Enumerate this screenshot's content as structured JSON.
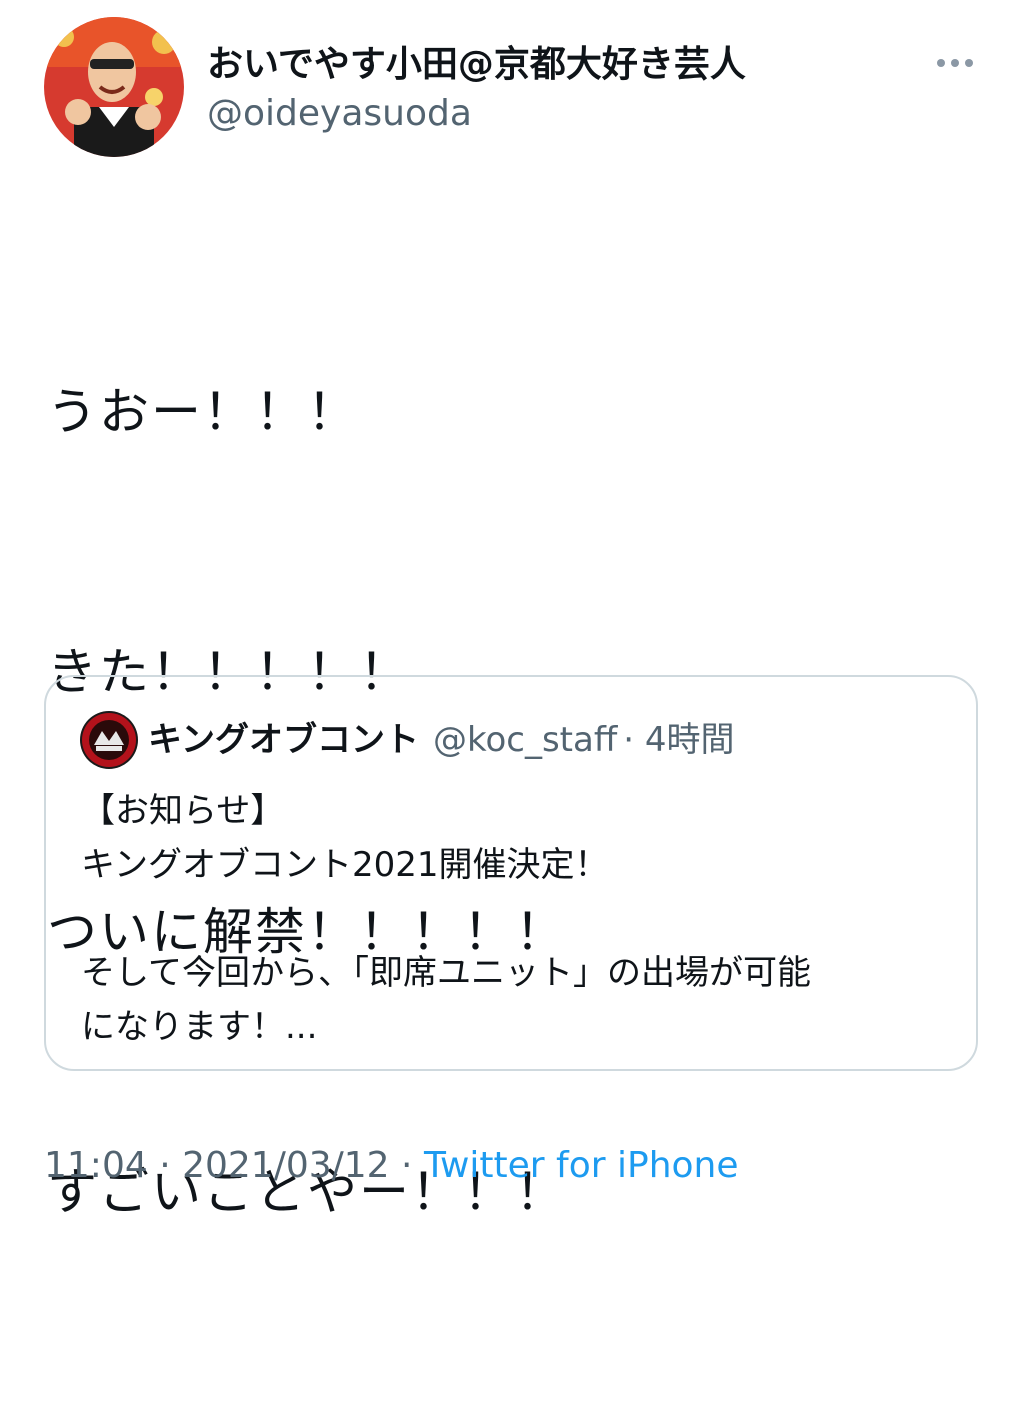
{
  "author": {
    "display_name": "おいでやす小田@京都大好き芸人",
    "handle": "@oideyasuoda"
  },
  "tweet": {
    "lines": [
      "うおー！！！",
      "きた！！！！！",
      "ついに解禁！！！！！",
      "すごいことやー！！！"
    ]
  },
  "quoted_tweet": {
    "display_name": "キングオブコント",
    "handle": "@koc_staff",
    "time": "· 4時間",
    "lines": [
      "【お知らせ】",
      "キングオブコント2021開催決定！",
      "",
      "そして今回から、「即席ユニット」の出場が可能",
      "になります！..."
    ]
  },
  "meta": {
    "time": "11:04",
    "separator": " · ",
    "date": "2021/03/12",
    "separator2": " · ",
    "source": "Twitter for iPhone"
  },
  "colors": {
    "text": "#0f1419",
    "secondary": "#536471",
    "link": "#1d9bf0",
    "border": "#cfd9de"
  },
  "icons": {
    "more": "more-horizontal-icon"
  }
}
